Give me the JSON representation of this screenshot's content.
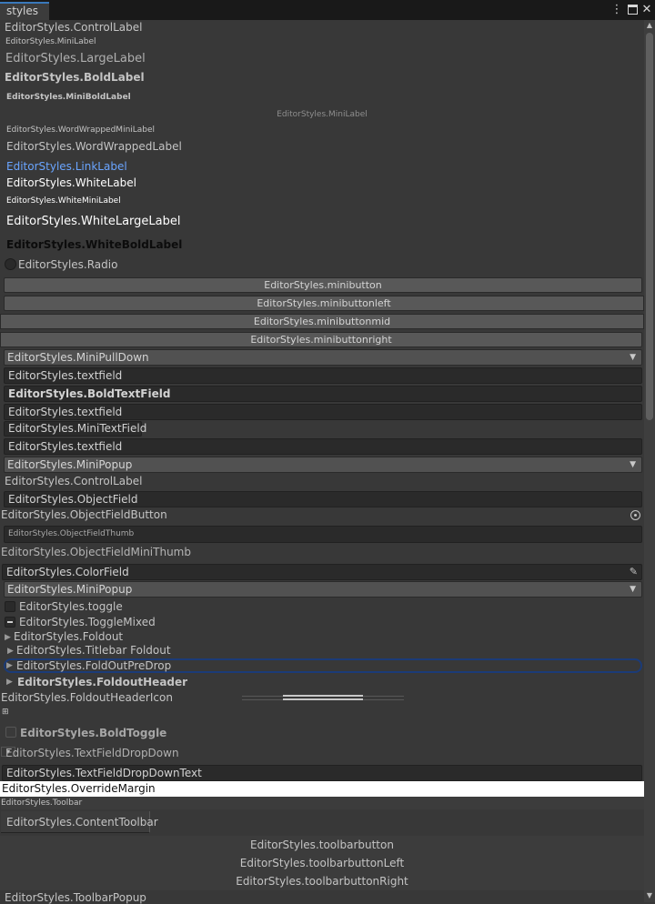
{
  "window": {
    "tab_title": "styles",
    "menu_icon": "kebab-menu-icon",
    "maximize_icon": "maximize-icon",
    "close_icon": "close-icon"
  },
  "items": {
    "control_label": "EditorStyles.ControlLabel",
    "mini_label": "EditorStyles.MiniLabel",
    "large_label": "EditorStyles.LargeLabel",
    "bold_label": "EditorStyles.BoldLabel",
    "mini_bold_label": "EditorStyles.MiniBoldLabel",
    "centered_mini_label": "EditorStyles.MiniLabel",
    "word_wrapped_mini_label": "EditorStyles.WordWrappedMiniLabel",
    "word_wrapped_label": "EditorStyles.WordWrappedLabel",
    "link_label": "EditorStyles.LinkLabel",
    "white_label": "EditorStyles.WhiteLabel",
    "white_mini_label": "EditorStyles.WhiteMiniLabel",
    "white_large_label": "EditorStyles.WhiteLargeLabel",
    "white_bold_label": "EditorStyles.WhiteBoldLabel",
    "radio": "EditorStyles.Radio",
    "minibutton": "EditorStyles.minibutton",
    "minibuttonleft": "EditorStyles.minibuttonleft",
    "minibuttonmid": "EditorStyles.minibuttonmid",
    "minibuttonright": "EditorStyles.minibuttonright",
    "mini_pulldown": "EditorStyles.MiniPullDown",
    "textfield_1": "EditorStyles.textfield",
    "bold_textfield": "EditorStyles.BoldTextField",
    "textfield_2": "EditorStyles.textfield",
    "mini_textfield": "EditorStyles.MiniTextField",
    "textfield_3": "EditorStyles.textfield",
    "mini_popup_1": "EditorStyles.MiniPopup",
    "control_label_2": "EditorStyles.ControlLabel",
    "object_field": "EditorStyles.ObjectField",
    "object_field_button": "EditorStyles.ObjectFieldButton",
    "object_field_thumb": "EditorStyles.ObjectFieldThumb",
    "object_field_mini_thumb": "EditorStyles.ObjectFieldMiniThumb",
    "color_field": "EditorStyles.ColorField",
    "mini_popup_2": "EditorStyles.MiniPopup",
    "toggle": "EditorStyles.toggle",
    "toggle_mixed": "EditorStyles.ToggleMixed",
    "foldout": "EditorStyles.Foldout",
    "titlebar_foldout": "EditorStyles.Titlebar Foldout",
    "foldout_predrop": "EditorStyles.FoldOutPreDrop",
    "foldout_header": "EditorStyles.FoldoutHeader",
    "foldout_header_icon": "EditorStyles.FoldoutHeaderIcon",
    "bold_toggle": "EditorStyles.BoldToggle",
    "textfield_dropdown": "EditorStyles.TextFieldDropDown",
    "textfield_dropdown_text": "EditorStyles.TextFieldDropDownText",
    "override_margin": "EditorStyles.OverrideMargin",
    "toolbar": "EditorStyles.Toolbar",
    "content_toolbar": "EditorStyles.ContentToolbar",
    "toolbarbutton": "EditorStyles.toolbarbutton",
    "toolbarbutton_left": "EditorStyles.toolbarbuttonLeft",
    "toolbarbutton_right": "EditorStyles.toolbarbuttonRight",
    "toolbar_popup": "EditorStyles.ToolbarPopup"
  },
  "colors": {
    "background": "#383838",
    "link": "#6aa5ff",
    "accent_outline": "#2a4a8a",
    "text": "#c4c4c4"
  }
}
